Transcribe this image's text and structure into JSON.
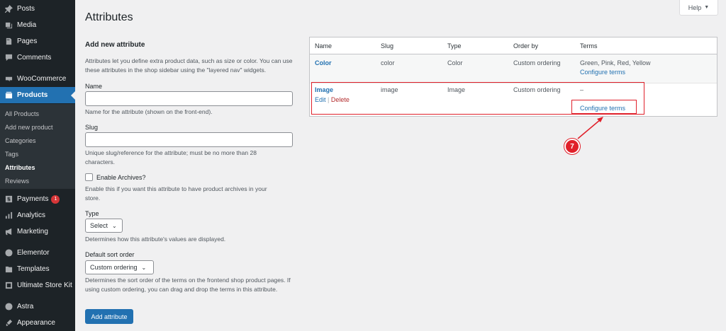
{
  "sidebar": {
    "menu": [
      {
        "label": "Posts",
        "icon": "pin-icon"
      },
      {
        "label": "Media",
        "icon": "media-icon"
      },
      {
        "label": "Pages",
        "icon": "pages-icon"
      },
      {
        "label": "Comments",
        "icon": "comments-icon"
      },
      {
        "label": "WooCommerce",
        "icon": "woocommerce-icon"
      },
      {
        "label": "Products",
        "icon": "products-icon"
      },
      {
        "label": "Payments",
        "icon": "payments-icon",
        "badge": "1"
      },
      {
        "label": "Analytics",
        "icon": "analytics-icon"
      },
      {
        "label": "Marketing",
        "icon": "marketing-icon"
      },
      {
        "label": "Elementor",
        "icon": "elementor-icon"
      },
      {
        "label": "Templates",
        "icon": "templates-icon"
      },
      {
        "label": "Ultimate Store Kit",
        "icon": "store-kit-icon"
      },
      {
        "label": "Astra",
        "icon": "astra-icon"
      },
      {
        "label": "Appearance",
        "icon": "appearance-icon"
      }
    ],
    "submenu": [
      "All Products",
      "Add new product",
      "Categories",
      "Tags",
      "Attributes",
      "Reviews"
    ]
  },
  "header": {
    "title": "Attributes",
    "help_label": "Help",
    "help_caret": "▼"
  },
  "form": {
    "heading": "Add new attribute",
    "intro": "Attributes let you define extra product data, such as size or color. You can use these attributes in the shop sidebar using the \"layered nav\" widgets.",
    "name_label": "Name",
    "name_help": "Name for the attribute (shown on the front-end).",
    "slug_label": "Slug",
    "slug_help": "Unique slug/reference for the attribute; must be no more than 28 characters.",
    "archives_label": "Enable Archives?",
    "archives_help": "Enable this if you want this attribute to have product archives in your store.",
    "type_label": "Type",
    "type_value": "Select",
    "type_help": "Determines how this attribute's values are displayed.",
    "sort_label": "Default sort order",
    "sort_value": "Custom ordering",
    "sort_help": "Determines the sort order of the terms on the frontend shop product pages. If using custom ordering, you can drag and drop the terms in this attribute.",
    "submit_label": "Add attribute"
  },
  "table": {
    "headers": [
      "Name",
      "Slug",
      "Type",
      "Order by",
      "Terms"
    ],
    "rows": [
      {
        "name": "Color",
        "slug": "color",
        "type": "Color",
        "order": "Custom ordering",
        "terms": "Green, Pink, Red, Yellow",
        "configure": "Configure terms"
      },
      {
        "name": "Image",
        "slug": "image",
        "type": "Image",
        "order": "Custom ordering",
        "terms": "–",
        "configure": "Configure terms",
        "edit": "Edit",
        "sep": "|",
        "delete": "Delete"
      }
    ]
  },
  "annotation": {
    "step": "7",
    "color": "#e0202a"
  },
  "colors": {
    "sidebar_bg": "#1d2327",
    "accent": "#2271b1",
    "badge": "#d63638"
  }
}
